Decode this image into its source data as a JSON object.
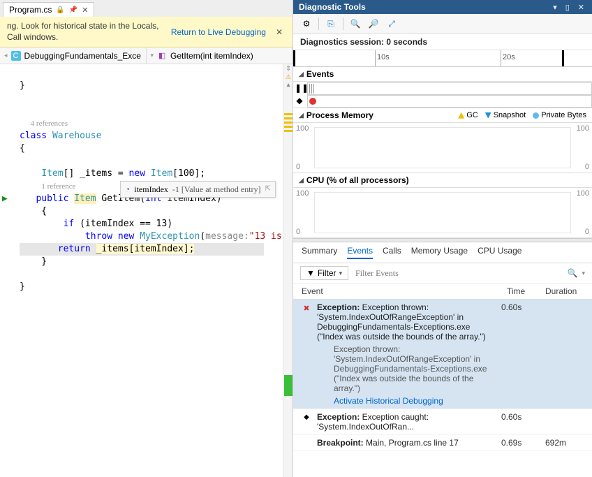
{
  "tab": {
    "name": "Program.cs"
  },
  "warning": {
    "text": "ng. Look for historical state in the Locals, Call windows.",
    "link": "Return to Live Debugging"
  },
  "breadcrumb": {
    "class": "DebuggingFundamentals_Exce",
    "method": "GetItem(int itemIndex)"
  },
  "code": {
    "refs1": "4 references",
    "refs2": "1 reference",
    "msgParam": "message:",
    "msgStr": "\"13 is"
  },
  "datatip": {
    "var": "itemIndex",
    "val": "-1 [Value at method entry]"
  },
  "panel": {
    "title": "Diagnostic Tools",
    "session": "Diagnostics session: 0 seconds",
    "ruler": {
      "t1": "10s",
      "t2": "20s"
    },
    "events": "Events",
    "procmem": "Process Memory",
    "gc": "GC",
    "snap": "Snapshot",
    "pb": "Private Bytes",
    "cpu": "CPU (% of all processors)",
    "yMem": "100",
    "y0": "0",
    "yCpu": "100"
  },
  "tabs": {
    "summary": "Summary",
    "events": "Events",
    "calls": "Calls",
    "mem": "Memory Usage",
    "cpu": "CPU Usage"
  },
  "filter": {
    "label": "Filter",
    "placeholder": "Filter Events"
  },
  "columns": {
    "event": "Event",
    "time": "Time",
    "dur": "Duration"
  },
  "rows": [
    {
      "kind": "exception",
      "selected": true,
      "title_b": "Exception:",
      "title": " Exception thrown: 'System.IndexOutOfRangeException' in DebuggingFundamentals-Exceptions.exe (\"Index was outside the bounds of the array.\")",
      "sub": "Exception thrown: 'System.IndexOutOfRangeException' in DebuggingFundamentals-Exceptions.exe (\"Index was outside the bounds of the array.\")",
      "link": "Activate Historical Debugging",
      "time": "0.60s",
      "dur": ""
    },
    {
      "kind": "caught",
      "title_b": "Exception:",
      "title": " Exception caught: 'System.IndexOutOfRan...",
      "time": "0.60s",
      "dur": ""
    },
    {
      "kind": "bp",
      "title_b": "Breakpoint:",
      "title": " Main, Program.cs line 17",
      "time": "0.69s",
      "dur": "692m"
    }
  ]
}
